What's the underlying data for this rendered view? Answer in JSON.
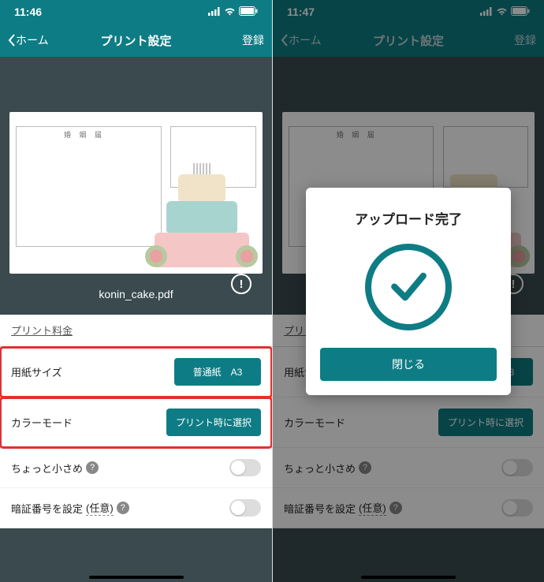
{
  "left": {
    "status_time": "11:46",
    "nav_back": "ホーム",
    "nav_title": "プリント設定",
    "nav_register": "登録",
    "doc_title": "婚 姻 届",
    "file_name": "konin_cake.pdf",
    "price_link": "プリント料金",
    "rows": {
      "paper_label": "用紙サイズ",
      "paper_value": "普通紙　A3",
      "color_label": "カラーモード",
      "color_value": "プリント時に選択",
      "small_label": "ちょっと小さめ",
      "pin_label": "暗証番号を設定",
      "pin_any": "(任意)"
    }
  },
  "right": {
    "status_time": "11:47",
    "nav_back": "ホーム",
    "nav_title": "プリント設定",
    "nav_register": "登録",
    "doc_title": "婚 姻 届",
    "price_link": "プリント料金",
    "rows": {
      "paper_label": "用紙サイズ",
      "paper_value": "普通紙　A3",
      "color_label": "カラーモード",
      "color_value": "プリント時に選択",
      "small_label": "ちょっと小さめ",
      "pin_label": "暗証番号を設定",
      "pin_any": "(任意)"
    },
    "modal": {
      "title": "アップロード完了",
      "close": "閉じる"
    }
  }
}
